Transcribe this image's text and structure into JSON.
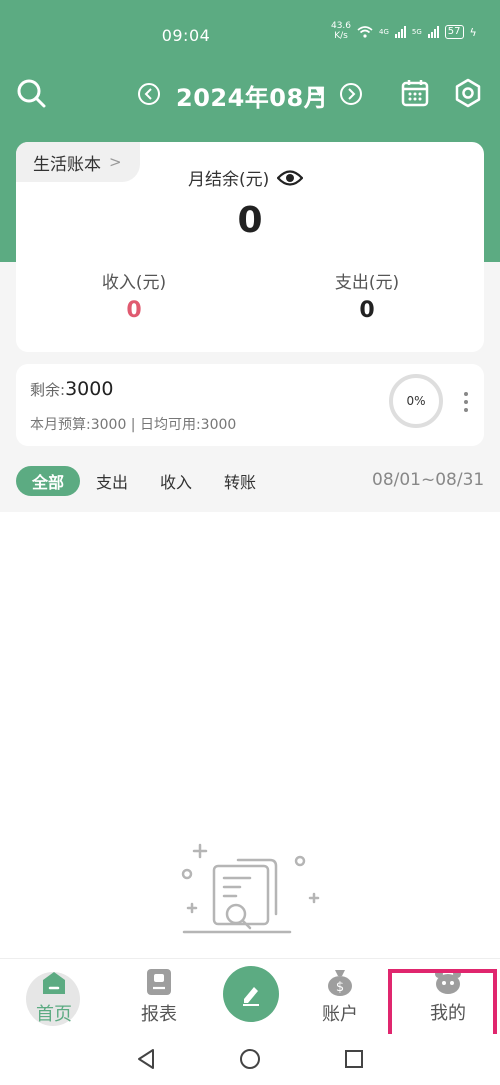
{
  "status_bar": {
    "time": "09:04",
    "net_speed_value": "43.6",
    "net_speed_unit": "K/s",
    "net_1": "4G",
    "net_2": "5G",
    "battery": "57"
  },
  "header": {
    "month": "2024年08月"
  },
  "summary": {
    "book_name": "生活账本",
    "balance_label": "月结余(元)",
    "balance_value": "0",
    "income_label": "收入(元)",
    "income_value": "0",
    "expense_label": "支出(元)",
    "expense_value": "0"
  },
  "budget": {
    "remaining_label": "剩余:",
    "remaining_value": "3000",
    "details": "本月预算:3000 | 日均可用:3000",
    "progress_percent": "0%"
  },
  "filters": {
    "tabs": [
      "全部",
      "支出",
      "收入",
      "转账"
    ],
    "active_index": 0,
    "date_range": "08/01~08/31"
  },
  "bottom_nav": {
    "items": [
      "首页",
      "报表",
      "账户",
      "我的"
    ],
    "active": "首页"
  },
  "colors": {
    "primary": "#5cab82",
    "income": "#e05a70",
    "highlight": "#e0266e"
  },
  "icons": [
    "search-icon",
    "prev-month-icon",
    "next-month-icon",
    "calendar-icon",
    "settings-icon",
    "eye-icon",
    "home-icon",
    "report-icon",
    "edit-icon",
    "account-icon",
    "profile-icon"
  ]
}
